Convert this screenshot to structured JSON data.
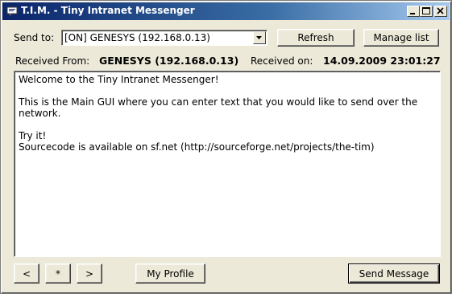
{
  "window": {
    "title": "T.I.M. - Tiny Intranet Messenger"
  },
  "icons": {
    "app": "app-icon",
    "minimize": "minimize-icon",
    "maximize": "maximize-icon",
    "close": "close-icon",
    "dropdown": "chevron-down-icon"
  },
  "colors": {
    "titlebar_start": "#0a246a",
    "titlebar_end": "#a6caf0",
    "face": "#ece9d8"
  },
  "send_to": {
    "label": "Send to:",
    "selected": "[ON] GENESYS (192.168.0.13)"
  },
  "toolbar": {
    "refresh_label": "Refresh",
    "manage_list_label": "Manage list"
  },
  "received": {
    "from_label": "Received From:",
    "from_value": "GENESYS (192.168.0.13)",
    "on_label": "Received on:",
    "on_value": "14.09.2009 23:01:27"
  },
  "message": {
    "text": "Welcome to the Tiny Intranet Messenger!\n\nThis is the Main GUI where you can enter text that you would like to send over the network.\n\nTry it!\nSourcecode is available on sf.net (http://sourceforge.net/projects/the-tim)"
  },
  "footer": {
    "prev_label": "<",
    "star_label": "*",
    "next_label": ">",
    "profile_label": "My Profile",
    "send_label": "Send Message"
  }
}
